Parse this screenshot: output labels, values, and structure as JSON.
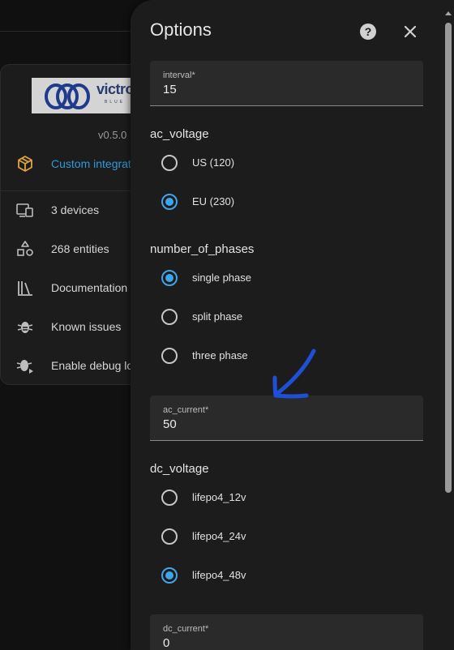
{
  "background": {
    "logo_text": "victron",
    "logo_subtext": "BLUE",
    "version": "v0.5.0",
    "items": [
      {
        "label": "Custom integrat",
        "icon": "package-icon"
      },
      {
        "label": "3 devices",
        "icon": "devices-icon"
      },
      {
        "label": "268 entities",
        "icon": "shapes-icon"
      },
      {
        "label": "Documentation",
        "icon": "books-icon"
      },
      {
        "label": "Known issues",
        "icon": "bug-icon"
      },
      {
        "label": "Enable debug lo",
        "icon": "bug-play-icon"
      }
    ]
  },
  "dialog": {
    "title": "Options",
    "fields": {
      "interval": {
        "label": "interval*",
        "value": "15"
      },
      "ac_current": {
        "label": "ac_current*",
        "value": "50"
      },
      "dc_current": {
        "label": "dc_current*",
        "value": "0"
      }
    },
    "sections": {
      "ac_voltage": {
        "label": "ac_voltage",
        "options": [
          {
            "label": "US (120)",
            "checked": false
          },
          {
            "label": "EU (230)",
            "checked": true
          }
        ]
      },
      "number_of_phases": {
        "label": "number_of_phases",
        "options": [
          {
            "label": "single phase",
            "checked": true
          },
          {
            "label": "split phase",
            "checked": false
          },
          {
            "label": "three phase",
            "checked": false
          }
        ]
      },
      "dc_voltage": {
        "label": "dc_voltage",
        "options": [
          {
            "label": "lifepo4_12v",
            "checked": false
          },
          {
            "label": "lifepo4_24v",
            "checked": false
          },
          {
            "label": "lifepo4_48v",
            "checked": true
          }
        ]
      }
    }
  },
  "colors": {
    "accent": "#3fa4e8",
    "link": "#2c9ad9",
    "icon_orange": "#e0a33a",
    "annotation": "#1f4fd6"
  }
}
